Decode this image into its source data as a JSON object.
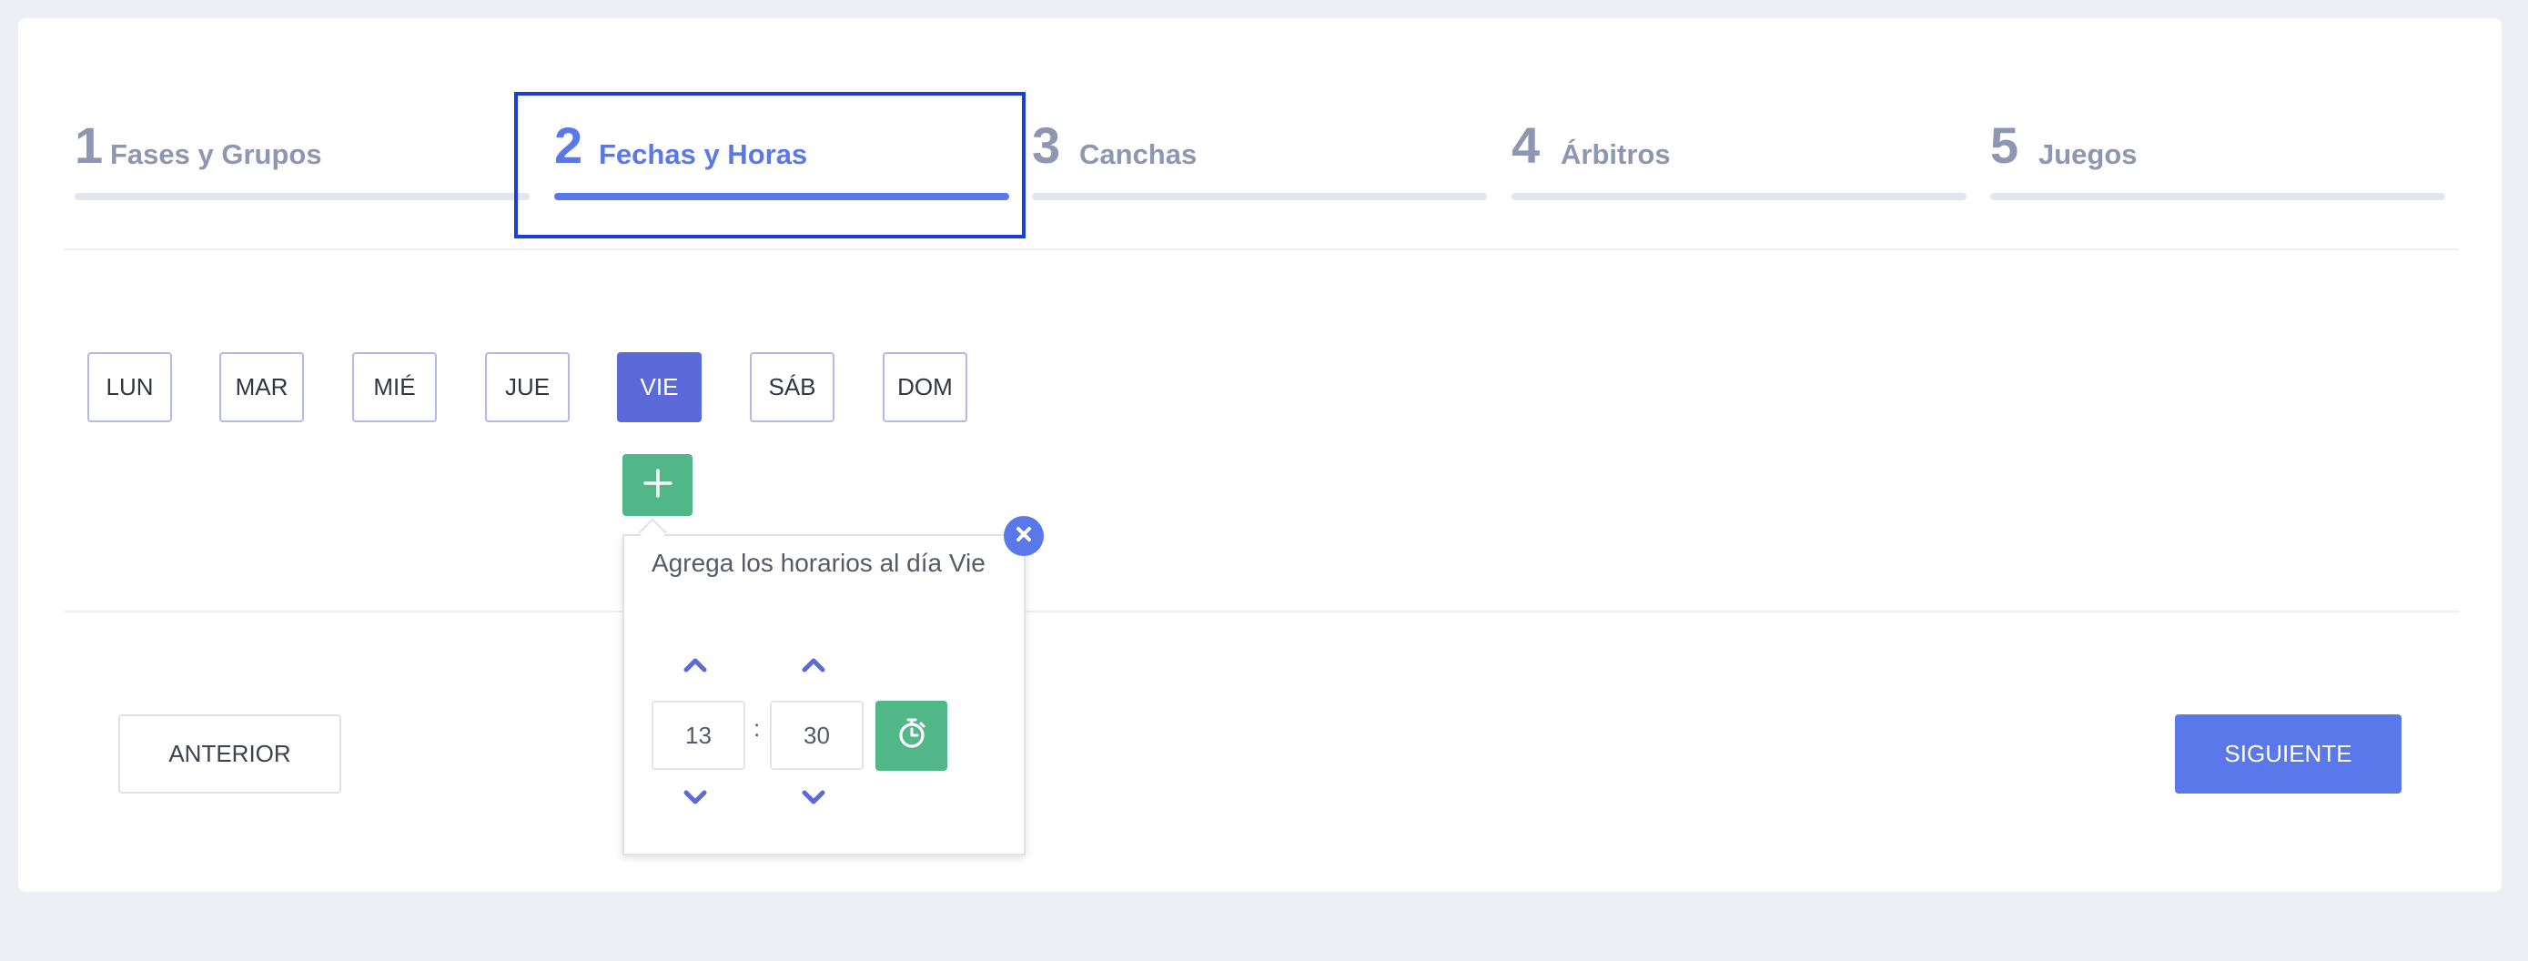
{
  "steps": [
    {
      "number": "1",
      "label": "Fases y Grupos",
      "active": false
    },
    {
      "number": "2",
      "label": "Fechas y Horas",
      "active": true
    },
    {
      "number": "3",
      "label": "Canchas",
      "active": false
    },
    {
      "number": "4",
      "label": "Árbitros",
      "active": false
    },
    {
      "number": "5",
      "label": "Juegos",
      "active": false
    }
  ],
  "days": [
    "LUN",
    "MAR",
    "MIÉ",
    "JUE",
    "VIE",
    "SÁB",
    "DOM"
  ],
  "selected_day": "VIE",
  "popup": {
    "title": "Agrega los horarios al día Vie",
    "hour": "13",
    "minute": "30",
    "separator": ":"
  },
  "buttons": {
    "previous": "ANTERIOR",
    "next": "SIGUIENTE"
  },
  "icons": {
    "add": "plus-icon",
    "close": "close-icon",
    "up": "chevron-up-icon",
    "down": "chevron-down-icon",
    "confirm": "stopwatch-icon"
  },
  "colors": {
    "accent": "#5a78ea",
    "selected_day": "#5b69d9",
    "success": "#52b788",
    "inactive_step": "#8e97b2",
    "highlight_border": "#1a3fd6"
  }
}
